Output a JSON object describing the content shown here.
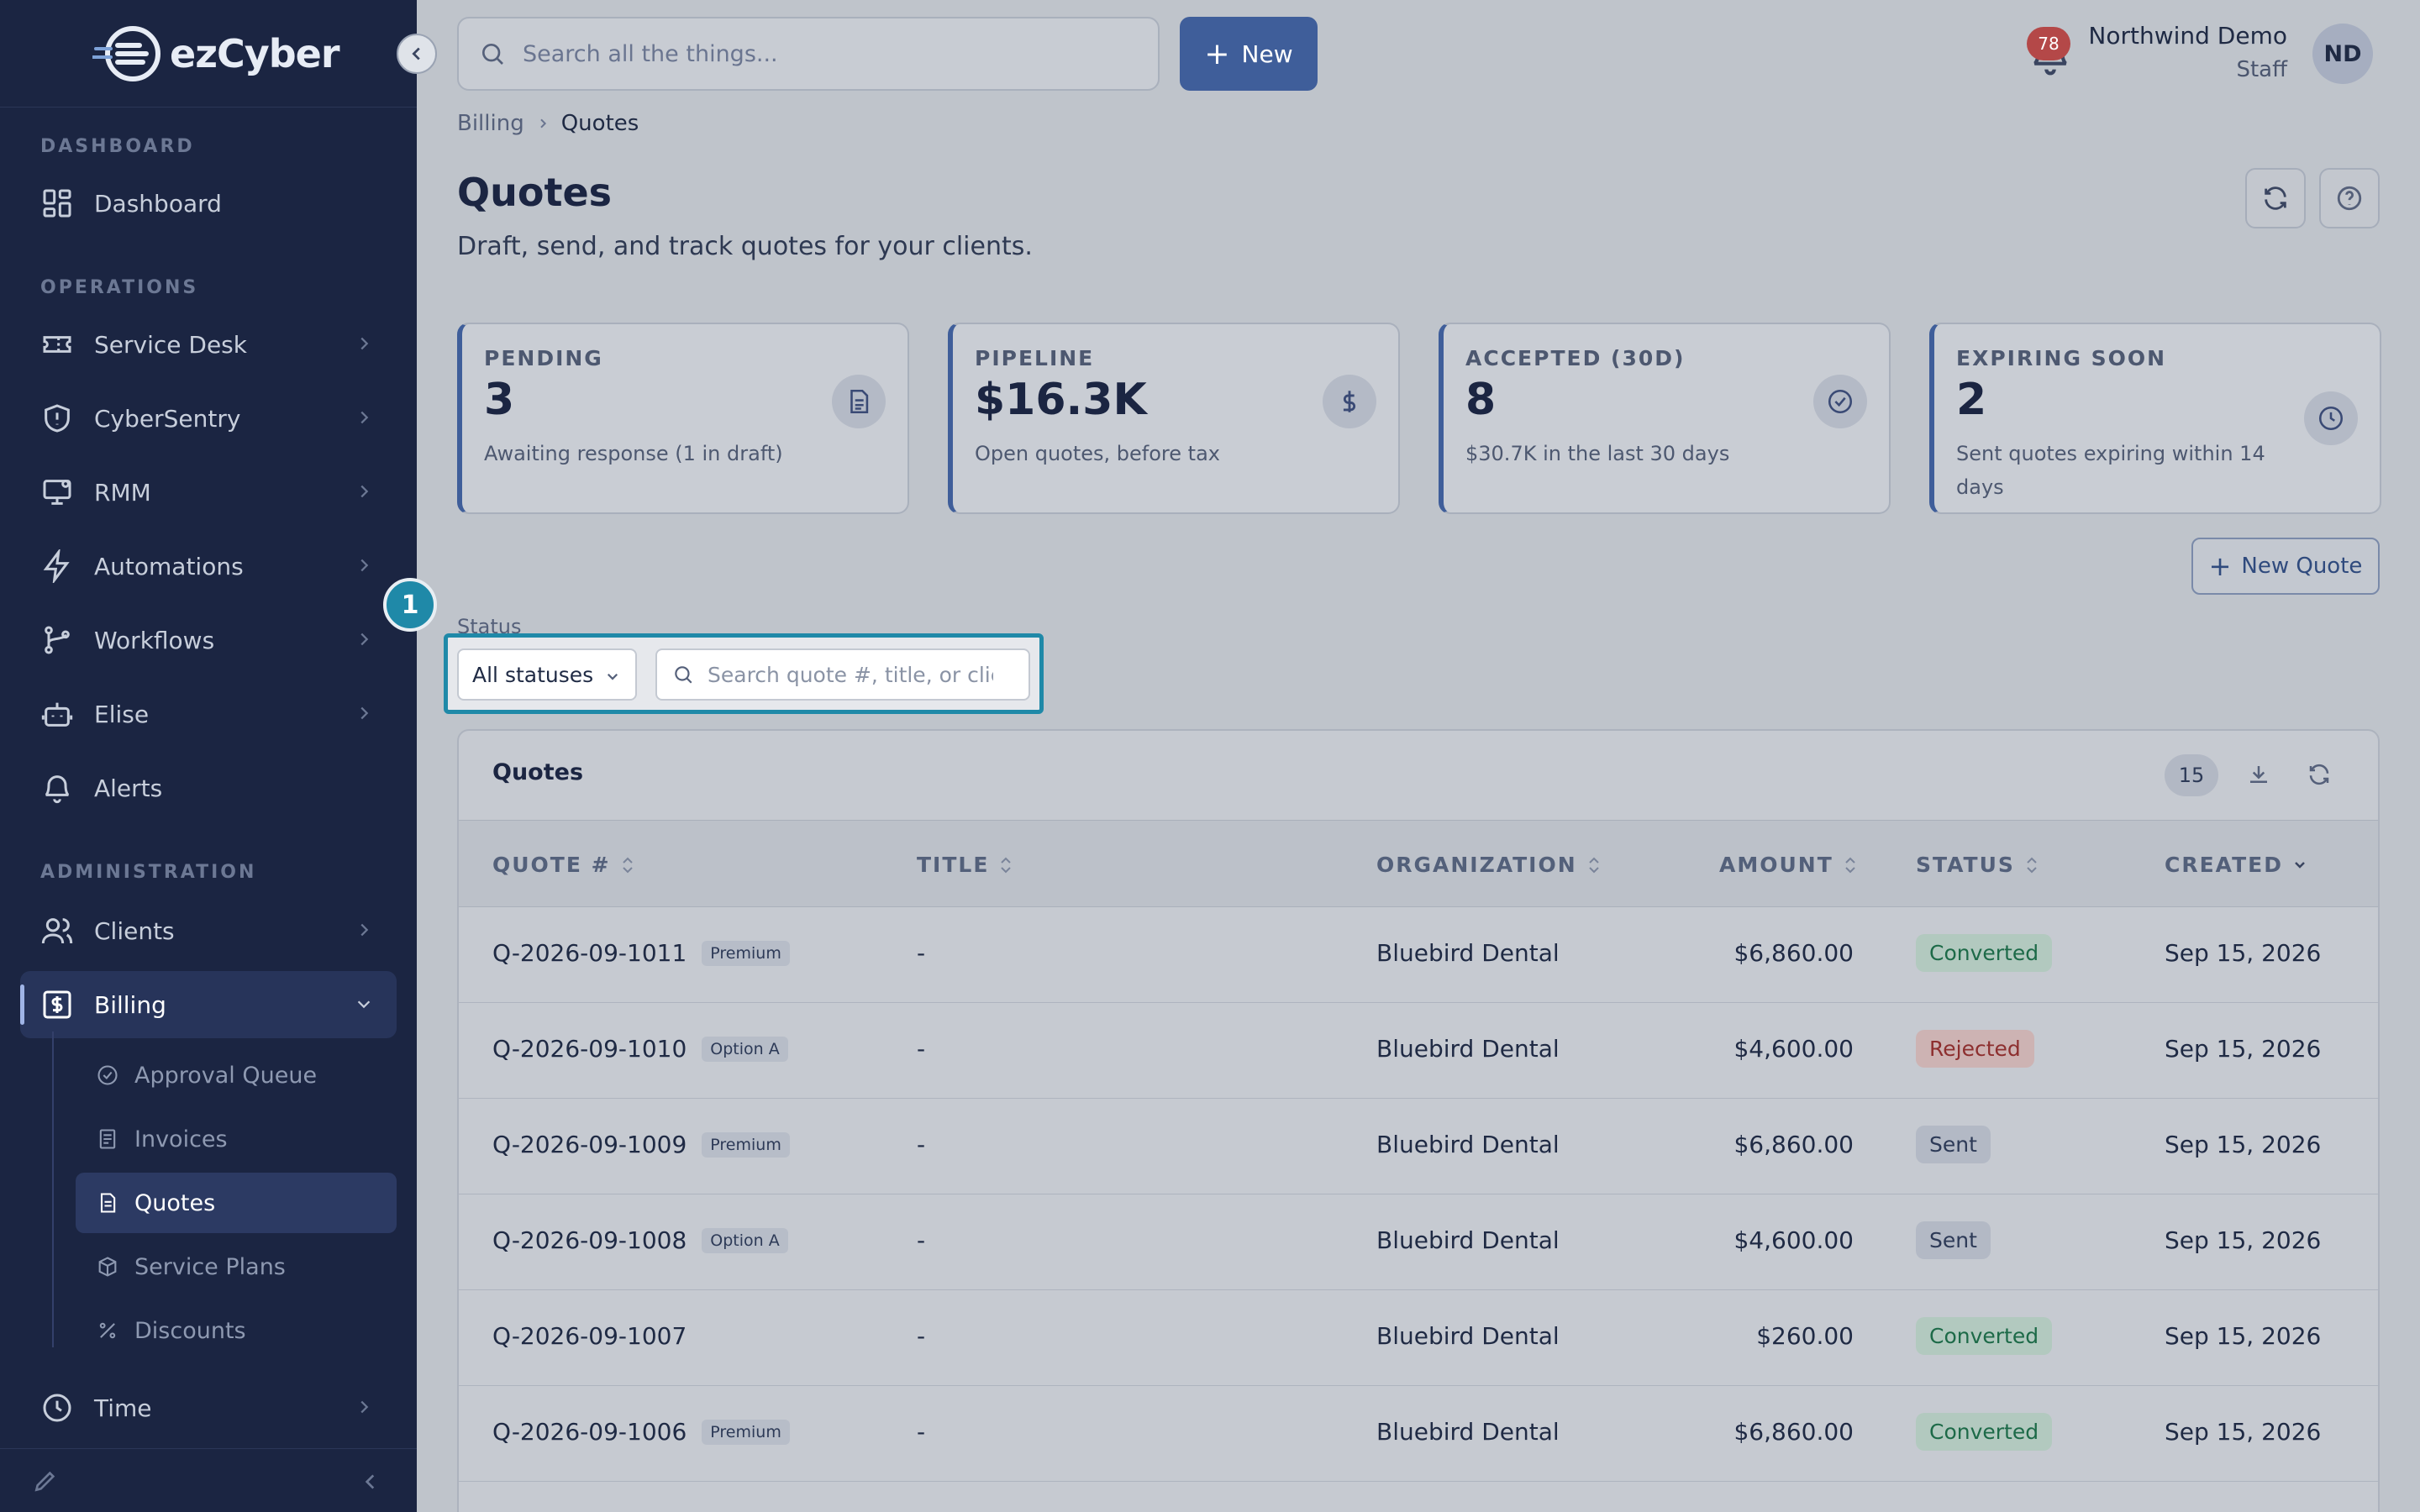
{
  "app": {
    "brand": "ezCyber"
  },
  "search": {
    "placeholder": "Search all the things..."
  },
  "topbar": {
    "new_label": "New",
    "notifications": "78",
    "user_name": "Northwind Demo",
    "user_role": "Staff",
    "avatar_initials": "ND"
  },
  "sidebar": {
    "sections": {
      "dashboard": "DASHBOARD",
      "operations": "OPERATIONS",
      "administration": "ADMINISTRATION"
    },
    "items": {
      "dashboard": "Dashboard",
      "service_desk": "Service Desk",
      "cybersentry": "CyberSentry",
      "rmm": "RMM",
      "automations": "Automations",
      "workflows": "Workflows",
      "elise": "Elise",
      "alerts": "Alerts",
      "clients": "Clients",
      "billing": "Billing",
      "time": "Time"
    },
    "billing_sub": {
      "approval_queue": "Approval Queue",
      "invoices": "Invoices",
      "quotes": "Quotes",
      "service_plans": "Service Plans",
      "discounts": "Discounts"
    }
  },
  "breadcrumb": {
    "parent": "Billing",
    "current": "Quotes"
  },
  "page": {
    "title": "Quotes",
    "subtitle": "Draft, send, and track quotes for your clients."
  },
  "stats": [
    {
      "label": "PENDING",
      "value": "3",
      "note": "Awaiting response (1 in draft)"
    },
    {
      "label": "PIPELINE",
      "value": "$16.3K",
      "note": "Open quotes, before tax"
    },
    {
      "label": "ACCEPTED (30D)",
      "value": "8",
      "note": "$30.7K in the last 30 days"
    },
    {
      "label": "EXPIRING SOON",
      "value": "2",
      "note": "Sent quotes expiring within 14 days"
    }
  ],
  "actions": {
    "new_quote": "New Quote"
  },
  "filters": {
    "status_label": "Status",
    "status_value": "All statuses",
    "search_placeholder": "Search quote #, title, or client",
    "step_number": "1"
  },
  "table": {
    "title": "Quotes",
    "count": "15",
    "columns": {
      "quote": "QUOTE #",
      "title": "TITLE",
      "organization": "ORGANIZATION",
      "amount": "AMOUNT",
      "status": "STATUS",
      "created": "CREATED"
    },
    "rows": [
      {
        "quote": "Q-2026-09-1011",
        "variant": "Premium",
        "title": "-",
        "organization": "Bluebird Dental",
        "amount": "$6,860.00",
        "status": "Converted",
        "created": "Sep 15, 2026"
      },
      {
        "quote": "Q-2026-09-1010",
        "variant": "Option A",
        "title": "-",
        "organization": "Bluebird Dental",
        "amount": "$4,600.00",
        "status": "Rejected",
        "created": "Sep 15, 2026"
      },
      {
        "quote": "Q-2026-09-1009",
        "variant": "Premium",
        "title": "-",
        "organization": "Bluebird Dental",
        "amount": "$6,860.00",
        "status": "Sent",
        "created": "Sep 15, 2026"
      },
      {
        "quote": "Q-2026-09-1008",
        "variant": "Option A",
        "title": "-",
        "organization": "Bluebird Dental",
        "amount": "$4,600.00",
        "status": "Sent",
        "created": "Sep 15, 2026"
      },
      {
        "quote": "Q-2026-09-1007",
        "variant": "",
        "title": "-",
        "organization": "Bluebird Dental",
        "amount": "$260.00",
        "status": "Converted",
        "created": "Sep 15, 2026"
      },
      {
        "quote": "Q-2026-09-1006",
        "variant": "Premium",
        "title": "-",
        "organization": "Bluebird Dental",
        "amount": "$6,860.00",
        "status": "Converted",
        "created": "Sep 15, 2026"
      }
    ]
  },
  "colors": {
    "sidebar": "#1b2542",
    "accent": "#3f5e9a",
    "highlight": "#1f89a8",
    "converted": "#1d6a48",
    "rejected": "#8d2f2f"
  }
}
